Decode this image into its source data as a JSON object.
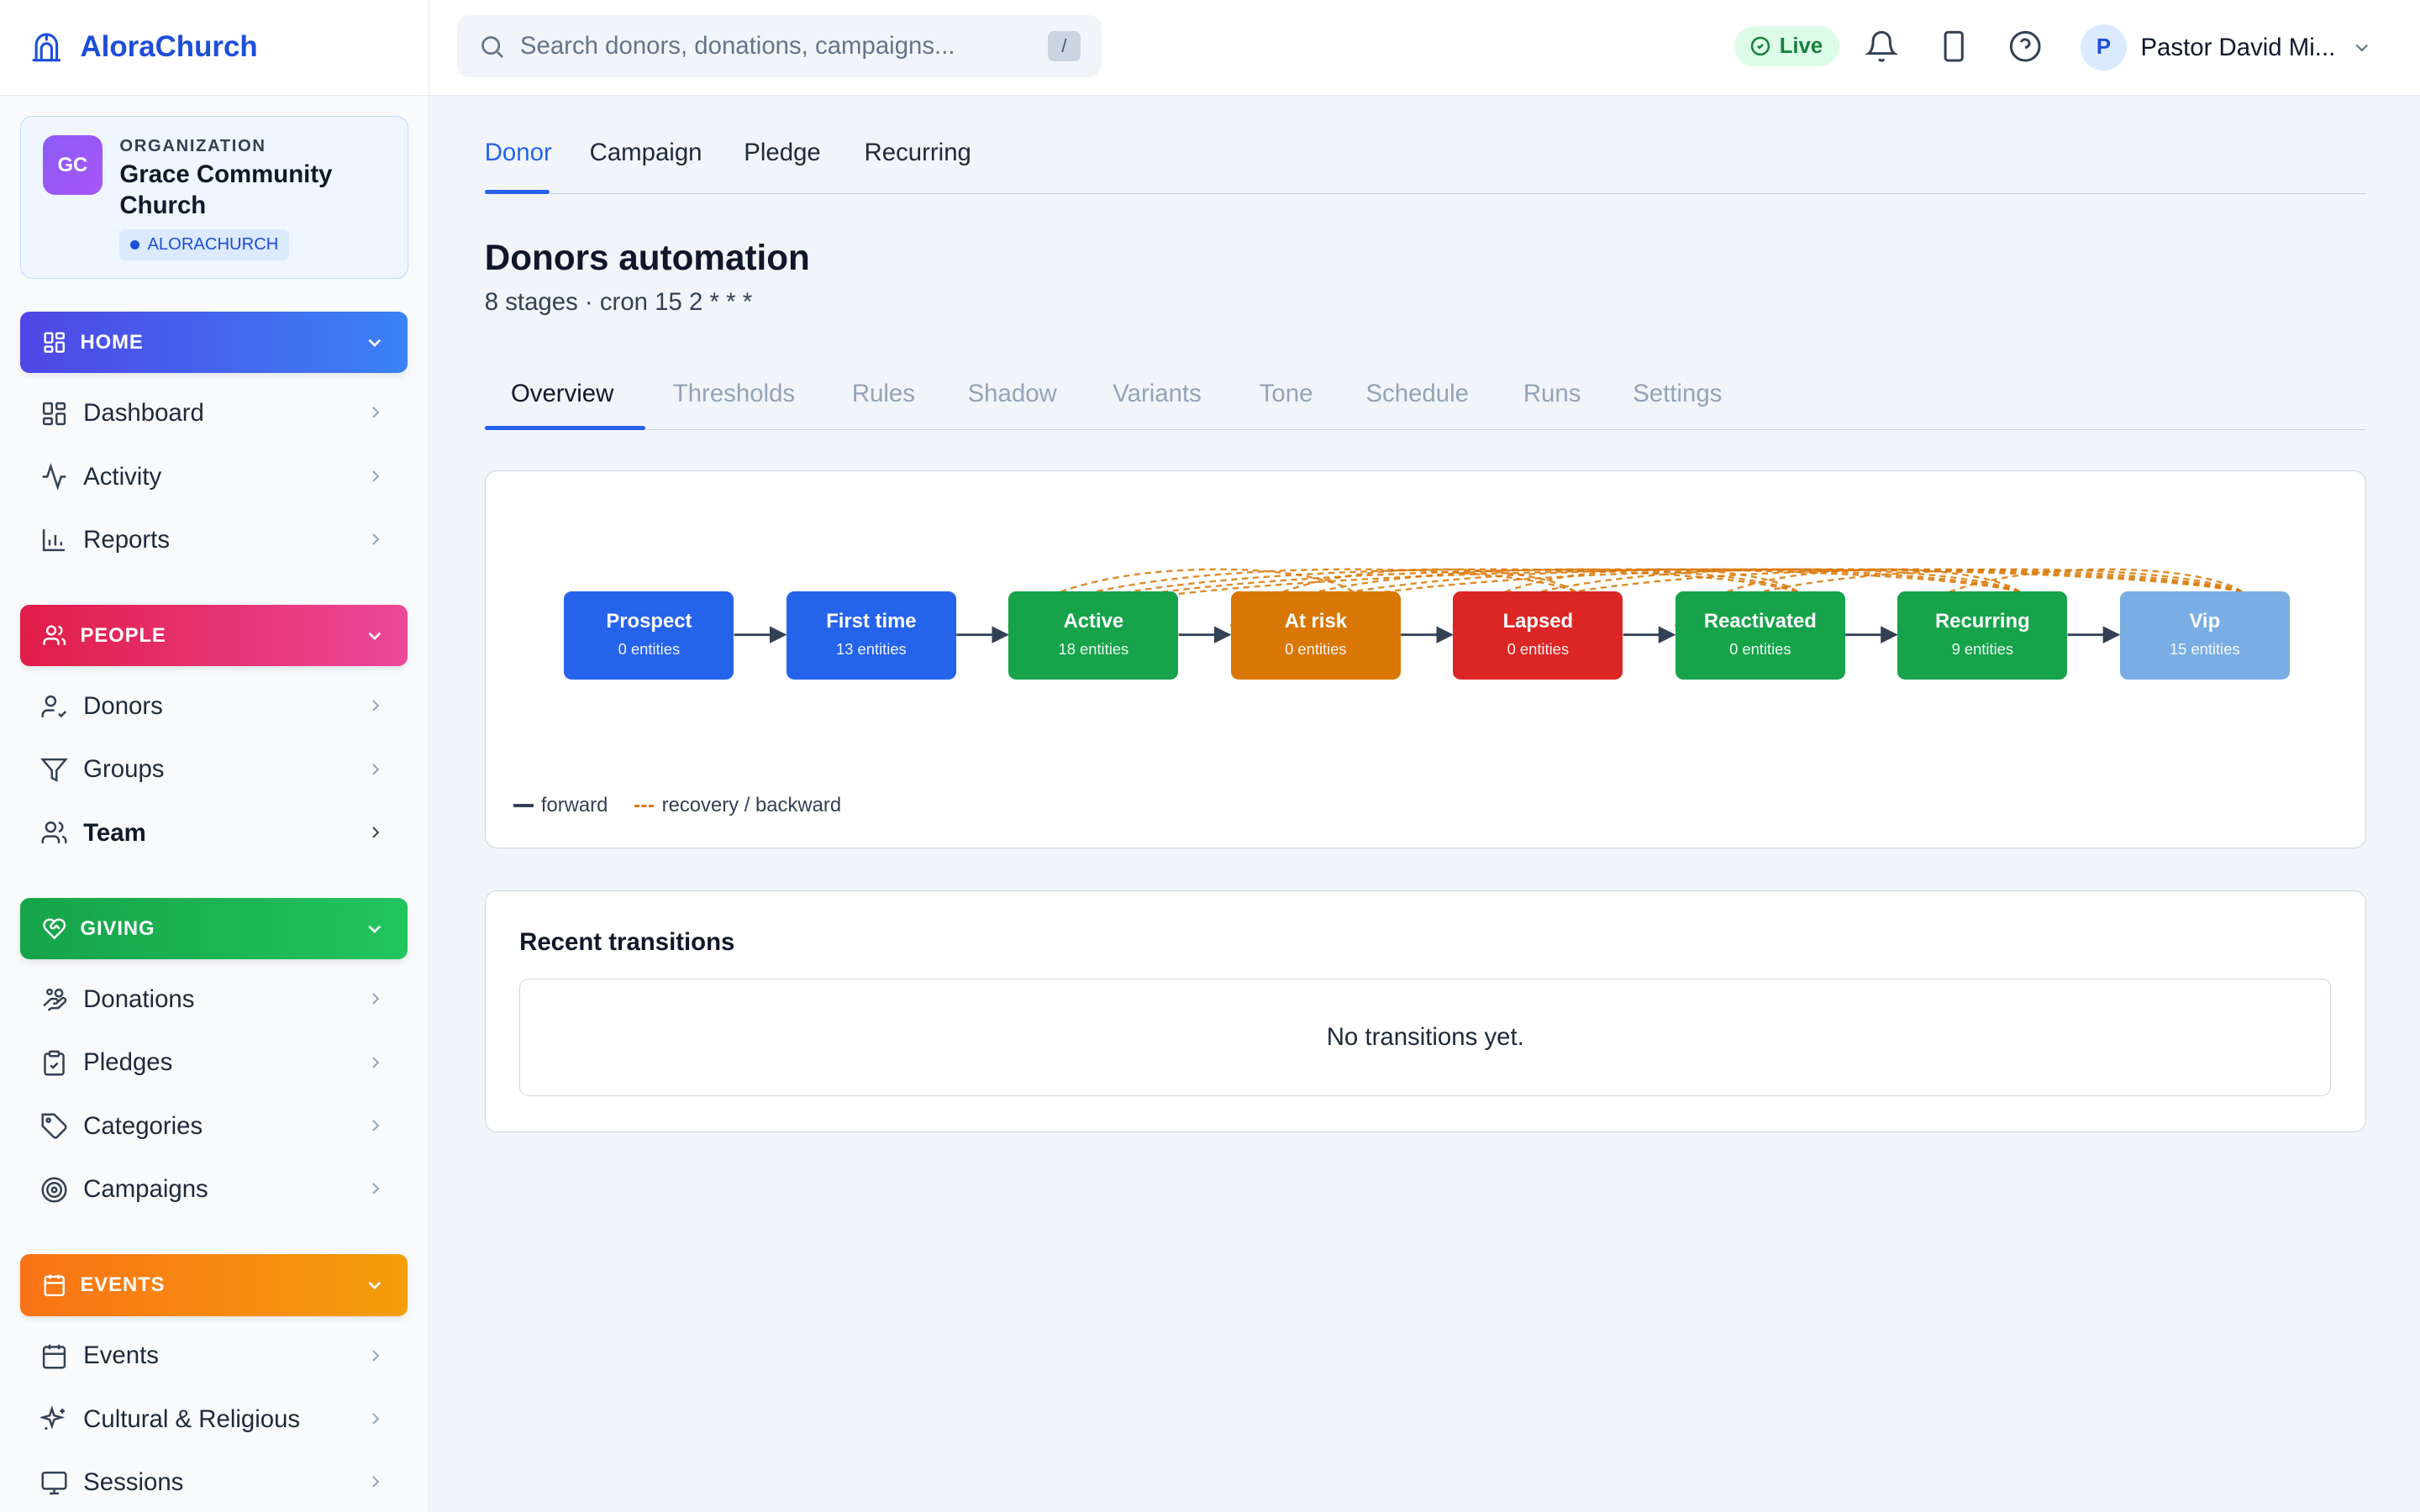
{
  "brand": {
    "name": "AloraChurch"
  },
  "org": {
    "kicker": "ORGANIZATION",
    "initials": "GC",
    "name": "Grace Community Church",
    "badge": "ALORACHURCH"
  },
  "sidebar": {
    "home": {
      "label": "HOME",
      "items": [
        {
          "label": "Dashboard"
        },
        {
          "label": "Activity"
        },
        {
          "label": "Reports"
        }
      ]
    },
    "people": {
      "label": "PEOPLE",
      "items": [
        {
          "label": "Donors"
        },
        {
          "label": "Groups"
        },
        {
          "label": "Team"
        }
      ]
    },
    "giving": {
      "label": "GIVING",
      "items": [
        {
          "label": "Donations"
        },
        {
          "label": "Pledges"
        },
        {
          "label": "Categories"
        },
        {
          "label": "Campaigns"
        }
      ]
    },
    "events": {
      "label": "EVENTS",
      "items": [
        {
          "label": "Events"
        },
        {
          "label": "Cultural & Religious"
        },
        {
          "label": "Sessions"
        }
      ]
    }
  },
  "topbar": {
    "search_placeholder": "Search donors, donations, campaigns...",
    "search_shortcut": "/",
    "live_label": "Live",
    "user_initial": "P",
    "user_name": "Pastor David Mi..."
  },
  "entity_tabs": [
    {
      "label": "Donor"
    },
    {
      "label": "Campaign"
    },
    {
      "label": "Pledge"
    },
    {
      "label": "Recurring"
    }
  ],
  "page": {
    "title": "Donors automation",
    "subtitle": "8 stages · cron 15 2 * * *"
  },
  "sub_tabs": [
    {
      "label": "Overview"
    },
    {
      "label": "Thresholds"
    },
    {
      "label": "Rules"
    },
    {
      "label": "Shadow"
    },
    {
      "label": "Variants"
    },
    {
      "label": "Tone"
    },
    {
      "label": "Schedule"
    },
    {
      "label": "Runs"
    },
    {
      "label": "Settings"
    }
  ],
  "stages": [
    {
      "name": "Prospect",
      "count": "0 entities",
      "color": "#2563eb"
    },
    {
      "name": "First time",
      "count": "13 entities",
      "color": "#2563eb"
    },
    {
      "name": "Active",
      "count": "18 entities",
      "color": "#16a34a"
    },
    {
      "name": "At risk",
      "count": "0 entities",
      "color": "#d97706"
    },
    {
      "name": "Lapsed",
      "count": "0 entities",
      "color": "#dc2626"
    },
    {
      "name": "Reactivated",
      "count": "0 entities",
      "color": "#16a34a"
    },
    {
      "name": "Recurring",
      "count": "9 entities",
      "color": "#16a34a"
    },
    {
      "name": "Vip",
      "count": "15 entities",
      "color": "#7aade3"
    }
  ],
  "legend": {
    "forward": "forward",
    "recovery": "recovery / backward"
  },
  "transitions": {
    "title": "Recent transitions",
    "empty": "No transitions yet."
  }
}
